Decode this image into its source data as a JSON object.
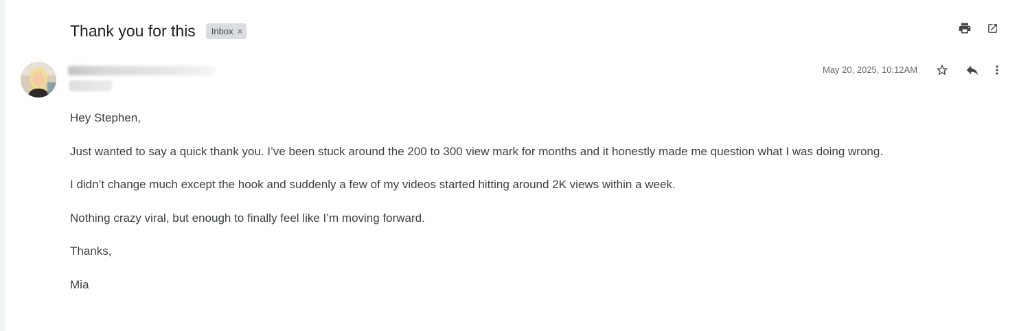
{
  "email": {
    "subject": "Thank you for this",
    "label": "Inbox",
    "label_remove": "×",
    "timestamp": "May 20, 2025, 10:12AM",
    "body": {
      "greeting": "Hey Stephen,",
      "paragraph_1": "Just wanted to say a quick thank you. I’ve been stuck around the 200 to 300 view mark for months and it honestly made me question what I was doing wrong.",
      "paragraph_2": "I didn’t change much except the hook and suddenly a few of my videos started hitting around 2K views within a week.",
      "paragraph_3": "Nothing crazy viral, but enough to finally feel like I’m moving forward.",
      "signoff": "Thanks,",
      "signature": "Mia"
    }
  },
  "icons": {
    "print": "print-icon",
    "open_new_window": "open-in-new-icon",
    "star": "star-icon",
    "reply": "reply-icon",
    "more": "more-vert-icon"
  }
}
